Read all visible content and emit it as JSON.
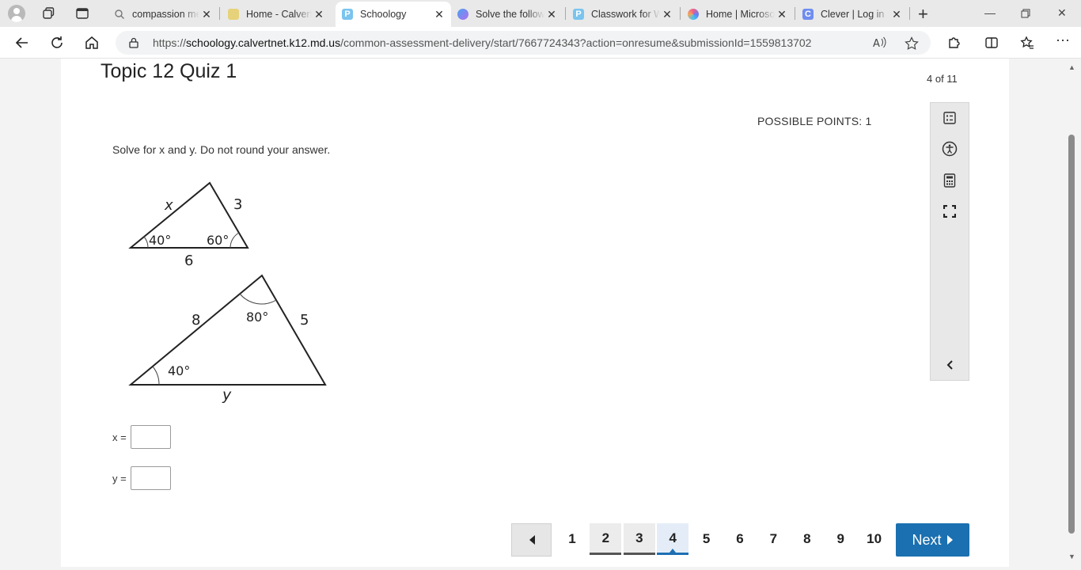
{
  "browser": {
    "tabs": [
      {
        "title": "compassion meaning",
        "favicon": "search-icon",
        "active": false
      },
      {
        "title": "Home - Calvert County",
        "favicon": "calvert-icon",
        "active": false
      },
      {
        "title": "Schoology",
        "favicon": "schoology-icon",
        "active": true
      },
      {
        "title": "Solve the following",
        "favicon": "copilot-icon",
        "active": false
      },
      {
        "title": "Classwork for World",
        "favicon": "schoology-icon",
        "active": false
      },
      {
        "title": "Home | Microsoft 365",
        "favicon": "microsoft365-icon",
        "active": false
      },
      {
        "title": "Clever | Log in",
        "favicon": "clever-icon",
        "active": false
      }
    ],
    "url_prefix": "https://",
    "url_host": "schoology.calvertnet.k12.md.us",
    "url_path": "/common-assessment-delivery/start/7667724343?action=onresume&submissionId=1559813702"
  },
  "quiz": {
    "title": "Topic 12 Quiz 1",
    "progress": "4 of 11",
    "possible_points": "POSSIBLE POINTS: 1",
    "question": "Solve for x and y.  Do not round your answer."
  },
  "figure": {
    "small_triangle": {
      "side_left": "x",
      "side_right": "3",
      "base": "6",
      "angle_left": "40°",
      "angle_right": "60°"
    },
    "large_triangle": {
      "side_left": "8",
      "side_right": "5",
      "base": "y",
      "angle_left": "40°",
      "angle_top": "80°"
    }
  },
  "answers": {
    "x_label": "x =",
    "x_value": "",
    "y_label": "y =",
    "y_value": ""
  },
  "pager": {
    "pages": [
      "1",
      "2",
      "3",
      "4",
      "5",
      "6",
      "7",
      "8",
      "9",
      "10"
    ],
    "visited": [
      "2",
      "3"
    ],
    "current": "4",
    "next_label": "Next"
  },
  "colors": {
    "accent": "#1a70b0",
    "current_page": "#1e6fb3"
  }
}
